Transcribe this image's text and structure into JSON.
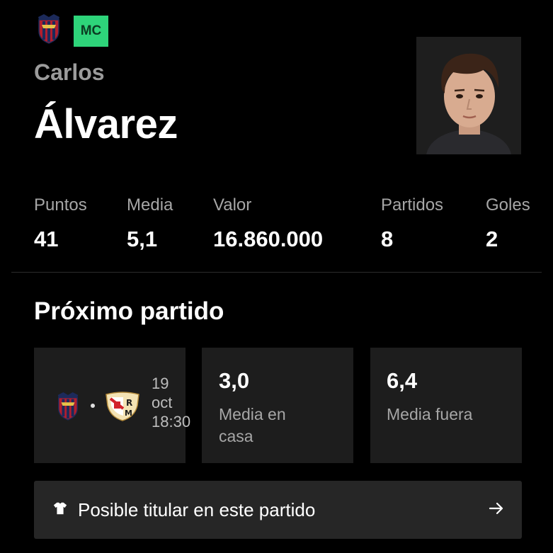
{
  "player": {
    "first_name": "Carlos",
    "last_name": "Álvarez",
    "position": "MC",
    "position_color": "#2ed47a",
    "club_icon": "levante-crest-icon"
  },
  "stats": [
    {
      "label": "Puntos",
      "value": "41"
    },
    {
      "label": "Media",
      "value": "5,1"
    },
    {
      "label": "Valor",
      "value": "16.860.000"
    },
    {
      "label": "Partidos",
      "value": "8"
    },
    {
      "label": "Goles",
      "value": "2"
    }
  ],
  "next_match": {
    "title": "Próximo partido",
    "home_icon": "levante-crest-icon",
    "away_icon": "rayo-vallecano-crest-icon",
    "date": "19\noct\n18:30",
    "home_avg": {
      "value": "3,0",
      "label": "Media en\ncasa"
    },
    "away_avg": {
      "value": "6,4",
      "label": "Media fuera"
    }
  },
  "cta": {
    "icon": "shirt-icon",
    "label": "Posible titular en este partido",
    "arrow_icon": "arrow-right-icon"
  }
}
